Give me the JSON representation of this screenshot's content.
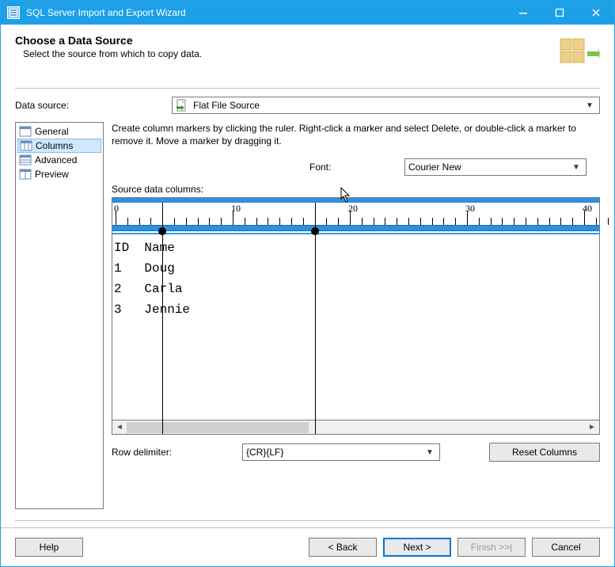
{
  "window": {
    "title": "SQL Server Import and Export Wizard"
  },
  "header": {
    "title": "Choose a Data Source",
    "subtitle": "Select the source from which to copy data."
  },
  "data_source": {
    "label": "Data source:",
    "value": "Flat File Source"
  },
  "sidebar": {
    "items": [
      {
        "label": "General"
      },
      {
        "label": "Columns"
      },
      {
        "label": "Advanced"
      },
      {
        "label": "Preview"
      }
    ],
    "selected_index": 1
  },
  "instructions": "Create column markers by clicking the ruler. Right-click a marker and select Delete, or double-click a marker to remove it. Move a marker by dragging it.",
  "font": {
    "label": "Font:",
    "value": "Courier New"
  },
  "source_columns_label": "Source data columns:",
  "ruler": {
    "major_every": 10,
    "max": 40
  },
  "markers": [
    4,
    17
  ],
  "preview_lines": [
    "ID  Name",
    "1   Doug",
    "2   Carla",
    "3   Jennie"
  ],
  "row_delimiter": {
    "label": "Row delimiter:",
    "value": "{CR}{LF}"
  },
  "buttons": {
    "reset_columns": "Reset Columns",
    "help": "Help",
    "back": "< Back",
    "next": "Next >",
    "finish": "Finish >>|",
    "cancel": "Cancel"
  }
}
